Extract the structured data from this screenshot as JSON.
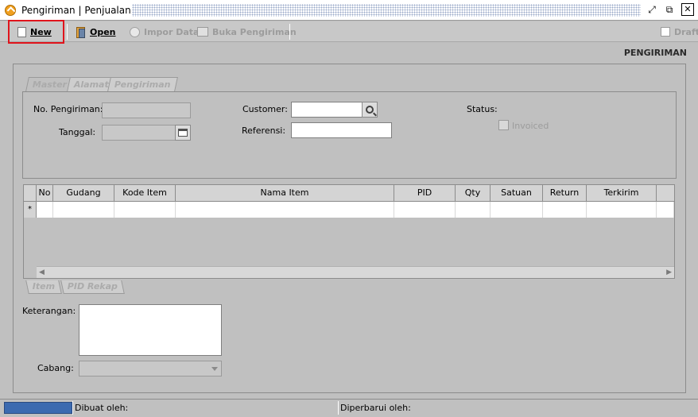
{
  "window": {
    "title": "Pengiriman | Penjualan"
  },
  "toolbar": {
    "new_label": "New",
    "open_label": "Open",
    "impor_label": "Impor Data",
    "buka_label": "Buka Pengiriman",
    "draft_label": "Draft"
  },
  "page": {
    "heading": "PENGIRIMAN"
  },
  "tabs": {
    "top": [
      "Master",
      "Alamat",
      "Pengiriman"
    ],
    "bottom": [
      "Item",
      "PID Rekap"
    ]
  },
  "form": {
    "no_pengiriman_label": "No. Pengiriman:",
    "no_pengiriman_value": "",
    "tanggal_label": "Tanggal:",
    "tanggal_value": "",
    "customer_label": "Customer:",
    "customer_value": "",
    "referensi_label": "Referensi:",
    "referensi_value": "",
    "status_label": "Status:",
    "invoiced_label": "Invoiced"
  },
  "grid": {
    "columns": [
      "No",
      "Gudang",
      "Kode Item",
      "Nama Item",
      "PID",
      "Qty",
      "Satuan",
      "Return",
      "Terkirim"
    ],
    "new_row_marker": "*"
  },
  "bottom": {
    "keterangan_label": "Keterangan:",
    "keterangan_value": "",
    "cabang_label": "Cabang:",
    "cabang_value": ""
  },
  "status": {
    "dibuat_label": "Dibuat oleh:",
    "diperbarui_label": "Diperbarui oleh:"
  },
  "colors": {
    "highlight": "#e0141c",
    "progress": "#3c6ab0",
    "background": "#c0c0c0"
  }
}
